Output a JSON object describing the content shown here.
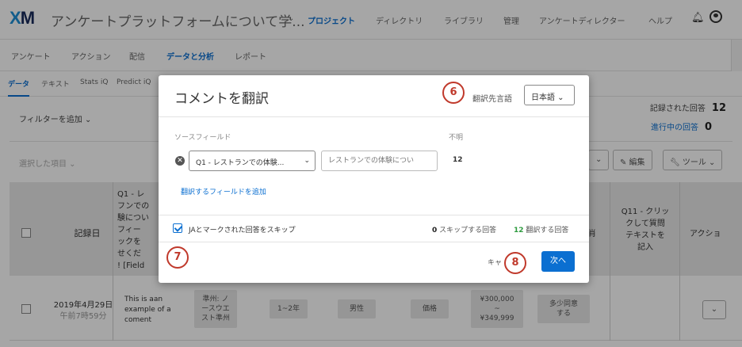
{
  "header": {
    "logo_x": "X",
    "logo_m": "M",
    "survey_title": "アンケートプラットフォームについて学...",
    "survey_caret": "⌄",
    "nav": [
      {
        "label": "プロジェクト",
        "active": true
      },
      {
        "label": "ディレクトリ"
      },
      {
        "label": "ライブラリ"
      },
      {
        "label": "管理"
      },
      {
        "label": "アンケートディレクター"
      },
      {
        "label": "ヘルプ"
      }
    ]
  },
  "subnav": {
    "items": [
      "アンケート",
      "アクション",
      "配信",
      "データと分析",
      "レポート"
    ],
    "active_index": 3
  },
  "tabnav": {
    "items": [
      "データ",
      "テキスト",
      "Stats iQ",
      "Predict iQ"
    ],
    "active_index": 0
  },
  "background": {
    "filter_add": "フィルターを追加 ⌄",
    "recorded_label": "記録された回答",
    "recorded_value": "12",
    "inprogress_label": "進行中の回答",
    "inprogress_value": "0",
    "selected_view": "選択した項目 ⌄",
    "edit_button": "✎ 編集",
    "tools_button": "ツール ⌄",
    "table": {
      "headers": {
        "date": "記録日",
        "q1_partial": "Q1 - レ\nフンでの\n験につい\nフィー\nックを\nせくだ\n! [Field",
        "q11": "Q11 - クリッ\nクして質問\nテキストを\n記入",
        "action": "アクショ",
        "hidden_col": "肖"
      },
      "row": {
        "date": "2019年4月29日",
        "time": "午前7時59分",
        "comment": "This is aan\nexample of a\ncoment",
        "region": "準州: ノ\nースウエ\nスト準州",
        "years": "1~2年",
        "gender": "男性",
        "price": "価格",
        "income": "¥300,000\n~\n¥349,999",
        "agree": "多少同意\nする",
        "dropdown": "⌄"
      }
    }
  },
  "modal": {
    "title": "コメントを翻訳",
    "target_label": "翻訳先言語",
    "target_value": "日本語 ⌄",
    "source_label": "ソースフィールド",
    "unknown_label": "不明",
    "remove_icon": "✕",
    "source_field": "Q1 - レストランでの体験...",
    "source_caret": "⌄",
    "source_input_placeholder": "レストランでの体験につい",
    "count": "12",
    "add_field": "翻訳するフィールドを追加",
    "skip_label": "JAとマークされた回答をスキップ",
    "skip_count_num": "0",
    "skip_count_text": "スキップする回答",
    "translate_count_num": "12",
    "translate_count_text": "翻訳する回答",
    "cancel": "キャ",
    "next": "次へ"
  },
  "annotations": {
    "badge_6": "6",
    "badge_7": "7",
    "badge_8": "8"
  },
  "colors": {
    "accent": "#0b6fd1",
    "badge": "#c0392b",
    "green": "#2e9b3f"
  }
}
